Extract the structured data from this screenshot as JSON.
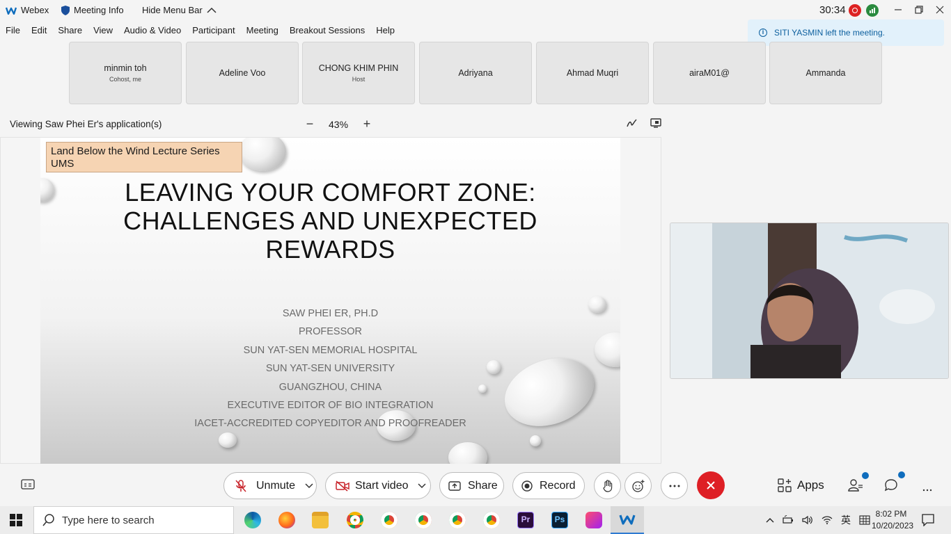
{
  "app": {
    "name": "Webex",
    "meeting_info": "Meeting Info",
    "hide_menu": "Hide Menu Bar",
    "timer": "30:34"
  },
  "menu": [
    "File",
    "Edit",
    "Share",
    "View",
    "Audio & Video",
    "Participant",
    "Meeting",
    "Breakout Sessions",
    "Help"
  ],
  "toast": {
    "text": "SITI YASMIN left the meeting."
  },
  "participants": [
    {
      "name": "minmin toh",
      "role": "Cohost, me"
    },
    {
      "name": "Adeline Voo",
      "role": ""
    },
    {
      "name": "CHONG KHIM PHIN",
      "role": "Host"
    },
    {
      "name": "Adriyana",
      "role": ""
    },
    {
      "name": "Ahmad Muqri",
      "role": ""
    },
    {
      "name": "airaM01@",
      "role": ""
    },
    {
      "name": "Ammanda",
      "role": ""
    }
  ],
  "sharing": {
    "label": "Viewing Saw Phei Er's application(s)",
    "zoom": "43%"
  },
  "slide": {
    "tag": "Land Below the Wind Lecture Series UMS",
    "title_lines": [
      "LEAVING YOUR COMFORT ZONE:",
      "CHALLENGES AND UNEXPECTED",
      "REWARDS"
    ],
    "lines": [
      "SAW PHEI ER, PH.D",
      "PROFESSOR",
      "SUN YAT-SEN MEMORIAL HOSPITAL",
      "SUN YAT-SEN UNIVERSITY",
      "GUANGZHOU, CHINA",
      "EXECUTIVE EDITOR OF BIO INTEGRATION",
      "IACET-ACCREDITED COPYEDITOR AND PROOFREADER"
    ]
  },
  "controls": {
    "unmute": "Unmute",
    "start_video": "Start video",
    "share": "Share",
    "record": "Record",
    "apps": "Apps"
  },
  "taskbar": {
    "search_placeholder": "Type here to search",
    "time": "8:02 PM",
    "date": "10/20/2023",
    "ime": "英"
  },
  "colors": {
    "end_call": "#de1f25",
    "toast_bg": "#e2f1fb",
    "slide_tag": "#f6d4b3",
    "webex_blue": "#0f6dbd"
  }
}
